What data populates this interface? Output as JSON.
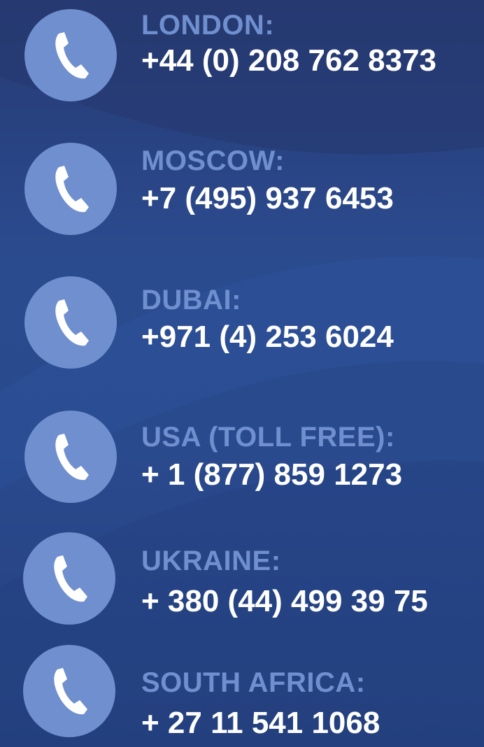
{
  "colors": {
    "background": "#2a4a8e",
    "accent": "#6f8fcf",
    "number": "#ffffff"
  },
  "icon": "phone-handset-icon",
  "contacts": [
    {
      "city": "LONDON:",
      "phone": "+44 (0) 208 762 8373"
    },
    {
      "city": "MOSCOW:",
      "phone": "+7 (495) 937 6453"
    },
    {
      "city": "DUBAI:",
      "phone": "+971 (4) 253 6024"
    },
    {
      "city": "USA (TOLL FREE):",
      "phone": "+ 1 (877) 859 1273"
    },
    {
      "city": "UKRAINE:",
      "phone": "+ 380 (44) 499 39 75"
    },
    {
      "city": "SOUTH AFRICA:",
      "phone": "+ 27 11 541 1068"
    }
  ]
}
